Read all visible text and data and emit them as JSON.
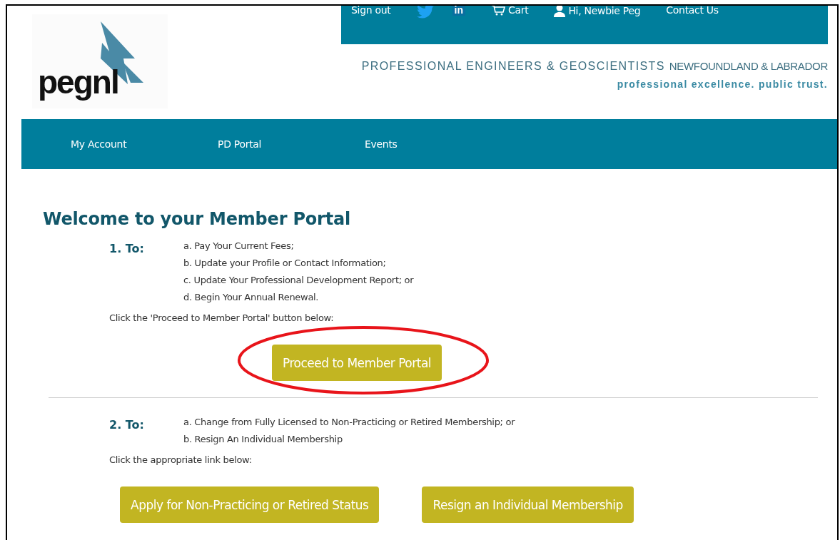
{
  "top_bar": {
    "links": [
      {
        "kind": "text",
        "label": "Sign out"
      },
      {
        "kind": "twitter"
      },
      {
        "kind": "linkedin",
        "label": "in"
      },
      {
        "kind": "cart",
        "label": "Cart"
      },
      {
        "kind": "user",
        "label": "Hi, Newbie Peg"
      },
      {
        "kind": "text",
        "label": "Contact Us"
      }
    ]
  },
  "logo": {
    "text": "pegnl"
  },
  "org": {
    "name": "PROFESSIONAL ENGINEERS & GEOSCIENTISTS",
    "region": "NEWFOUNDLAND & LABRADOR",
    "tagline": "professional excellence. public trust."
  },
  "nav": [
    {
      "label": "My Account"
    },
    {
      "label": "PD Portal"
    },
    {
      "label": "Events"
    }
  ],
  "title": "Welcome to your Member Portal",
  "sections": [
    {
      "heading": "1. To:",
      "items": [
        "a. Pay Your Current Fees;",
        "b. Update your Profile or Contact Information;",
        "c. Update Your Professional Development Report; or",
        "d. Begin Your Annual Renewal."
      ],
      "instruction": "Click the 'Proceed to Member Portal' button below:",
      "buttons": [
        {
          "label": "Proceed to Member Portal",
          "circled": true
        }
      ]
    },
    {
      "heading": "2. To:",
      "items": [
        "a. Change from Fully Licensed to Non-Practicing or Retired Membership; or",
        "b. Resign An Individual Membership"
      ],
      "instruction": "Click the appropriate link below:",
      "buttons": [
        {
          "label": "Apply for Non-Practicing or Retired Status",
          "circled": false
        },
        {
          "label": "Resign an Individual Membership",
          "circled": false
        }
      ]
    }
  ]
}
